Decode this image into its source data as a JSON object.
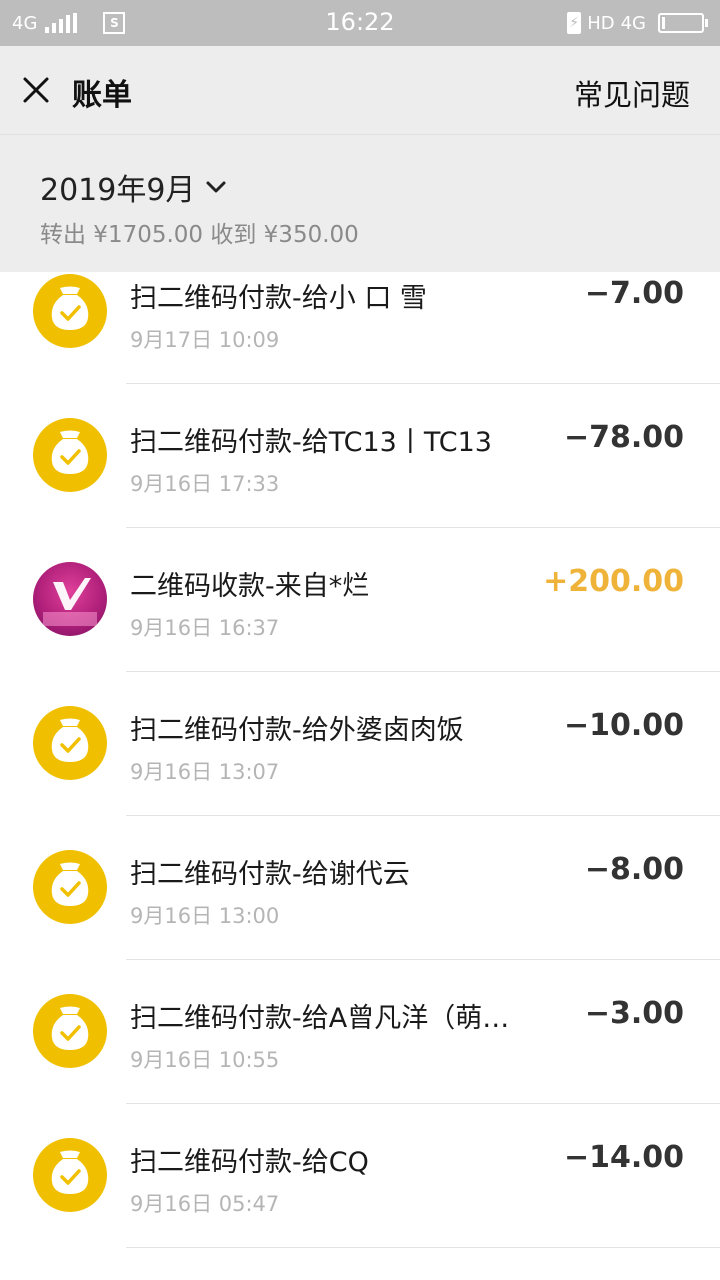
{
  "status_bar": {
    "network": "4G",
    "time": "16:22",
    "hd": "HD",
    "network_right": "4G",
    "battery_level": 0.08
  },
  "header": {
    "title": "账单",
    "faq": "常见问题"
  },
  "summary": {
    "month": "2019年9月",
    "totals": "转出 ¥1705.00 收到 ¥350.00"
  },
  "transactions": [
    {
      "name": "扫二维码付款-给小 口 雪",
      "date": "9月17日 10:09",
      "amount": "−7.00",
      "type": "payment"
    },
    {
      "name": "扫二维码付款-给TC13丨TC13",
      "date": "9月16日 17:33",
      "amount": "−78.00",
      "type": "payment"
    },
    {
      "name": "二维码收款-来自*烂",
      "date": "9月16日 16:37",
      "amount": "+200.00",
      "type": "income"
    },
    {
      "name": "扫二维码付款-给外婆卤肉饭",
      "date": "9月16日 13:07",
      "amount": "−10.00",
      "type": "payment"
    },
    {
      "name": "扫二维码付款-给谢代云",
      "date": "9月16日 13:00",
      "amount": "−8.00",
      "type": "payment"
    },
    {
      "name": "扫二维码付款-给A曾凡洋（萌…",
      "date": "9月16日 10:55",
      "amount": "−3.00",
      "type": "payment"
    },
    {
      "name": "扫二维码付款-给CQ",
      "date": "9月16日 05:47",
      "amount": "−14.00",
      "type": "payment"
    }
  ],
  "colors": {
    "accent_yellow": "#f0c000",
    "income_amount": "#efb33a"
  }
}
